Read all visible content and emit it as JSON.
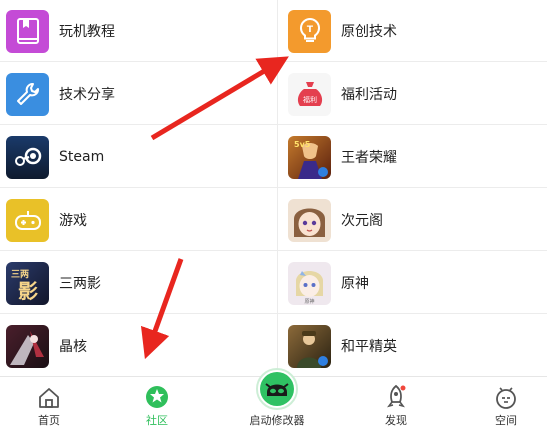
{
  "grid": {
    "rows": [
      {
        "left": {
          "label": "玩机教程",
          "icon": "book-icon",
          "color": "#c44bd6"
        },
        "right": {
          "label": "原创技术",
          "icon": "lightbulb-icon",
          "color": "#f39a2d"
        }
      },
      {
        "left": {
          "label": "技术分享",
          "icon": "wrench-icon",
          "color": "#3a8ee0"
        },
        "right": {
          "label": "福利活动",
          "icon": "money-bag-icon",
          "color": "#f0f0f0"
        }
      },
      {
        "left": {
          "label": "Steam",
          "icon": "steam-logo-icon",
          "color": "#1b2838"
        },
        "right": {
          "label": "王者荣耀",
          "icon": "honor-of-kings-icon",
          "color": "#7a3c16"
        }
      },
      {
        "left": {
          "label": "游戏",
          "icon": "gamepad-icon",
          "color": "#e9c128"
        },
        "right": {
          "label": "次元阁",
          "icon": "anime-girl-icon",
          "color": "#e7d4c3"
        }
      },
      {
        "left": {
          "label": "三两影",
          "icon": "sanliangying-icon",
          "color": "#1f2a4a"
        },
        "right": {
          "label": "原神",
          "icon": "genshin-icon",
          "color": "#e8dfe8"
        }
      },
      {
        "left": {
          "label": "晶核",
          "icon": "jinghe-icon",
          "color": "#3a1d22"
        },
        "right": {
          "label": "和平精英",
          "icon": "peace-elite-icon",
          "color": "#5a4a2a"
        }
      }
    ]
  },
  "tabbar": {
    "home": "首页",
    "community": "社区",
    "launcher": "启动修改器",
    "discover": "发现",
    "space": "空间",
    "active_color": "#2fbf5b"
  }
}
